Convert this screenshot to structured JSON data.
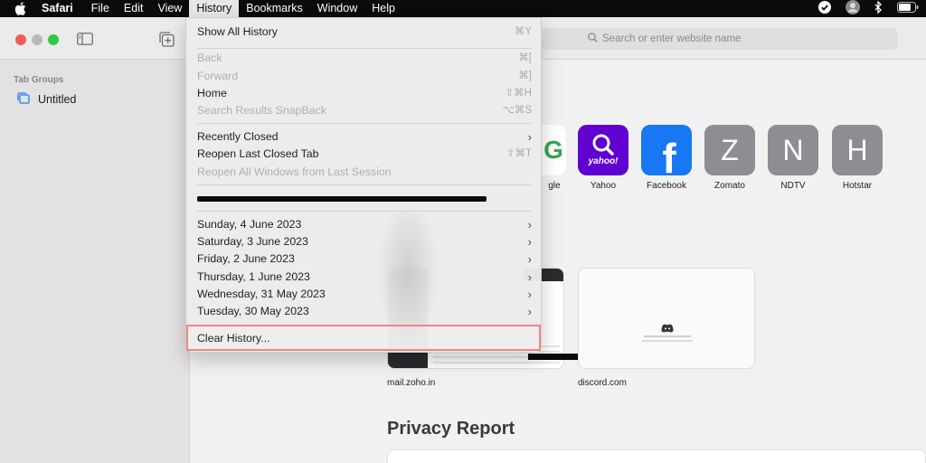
{
  "menubar": {
    "app": "Safari",
    "items": [
      "File",
      "Edit",
      "View",
      "History",
      "Bookmarks",
      "Window",
      "Help"
    ],
    "active": "History"
  },
  "toolbar": {
    "search_placeholder": "Search or enter website name"
  },
  "sidebar": {
    "header": "Tab Groups",
    "item": "Untitled"
  },
  "history_menu": {
    "show_all": {
      "label": "Show All History",
      "shortcut": "⌘Y"
    },
    "back": {
      "label": "Back",
      "shortcut": "⌘["
    },
    "forward": {
      "label": "Forward",
      "shortcut": "⌘]"
    },
    "home": {
      "label": "Home",
      "shortcut": "⇧⌘H"
    },
    "snapback": {
      "label": "Search Results SnapBack",
      "shortcut": "⌥⌘S"
    },
    "recently_closed": {
      "label": "Recently Closed"
    },
    "reopen_tab": {
      "label": "Reopen Last Closed Tab",
      "shortcut": "⇧⌘T"
    },
    "reopen_windows": {
      "label": "Reopen All Windows from Last Session"
    },
    "dates": [
      "Sunday, 4 June 2023",
      "Saturday, 3 June 2023",
      "Friday, 2 June 2023",
      "Thursday, 1 June 2023",
      "Wednesday, 31 May 2023",
      "Tuesday, 30 May 2023"
    ],
    "clear": {
      "label": "Clear History..."
    }
  },
  "favorites": [
    {
      "label": "Google",
      "visible_label": "gle"
    },
    {
      "label": "Yahoo",
      "glyph": "yahoo!"
    },
    {
      "label": "Facebook",
      "glyph": "f"
    },
    {
      "label": "Zomato",
      "glyph": "Z"
    },
    {
      "label": "NDTV",
      "glyph": "N"
    },
    {
      "label": "Hotstar",
      "glyph": "H"
    }
  ],
  "frequently_visited": [
    {
      "label": "mail.zoho.in"
    },
    {
      "label": "discord.com"
    }
  ],
  "privacy_report": {
    "title": "Privacy Report"
  },
  "colors": {
    "yahoo": "#6001d2",
    "facebook": "#1877f2",
    "grey_tile": "#8e8d93",
    "highlight": "#f08682"
  }
}
